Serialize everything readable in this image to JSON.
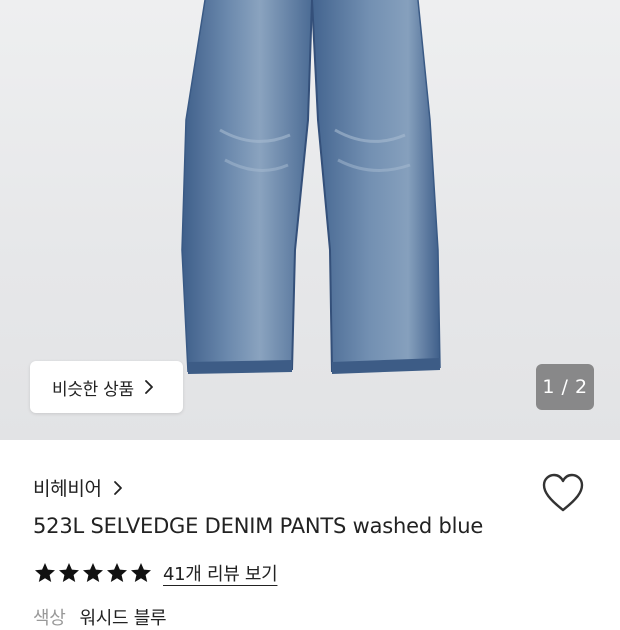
{
  "gallery": {
    "similar_button_label": "비슷한 상품",
    "image_counter": "1 / 2"
  },
  "product": {
    "brand": "비헤비어",
    "title": "523L SELVEDGE DENIM PANTS washed blue",
    "rating": 5,
    "review_link": "41개 리뷰 보기",
    "color_label": "색상",
    "color_value": "워시드 블루"
  },
  "icons": [
    "chevron-right-icon",
    "heart-outline-icon",
    "star-icon"
  ],
  "colors": {
    "denim": "#4e6f98",
    "text": "#222222",
    "counter_bg": "#6e6e6e"
  }
}
